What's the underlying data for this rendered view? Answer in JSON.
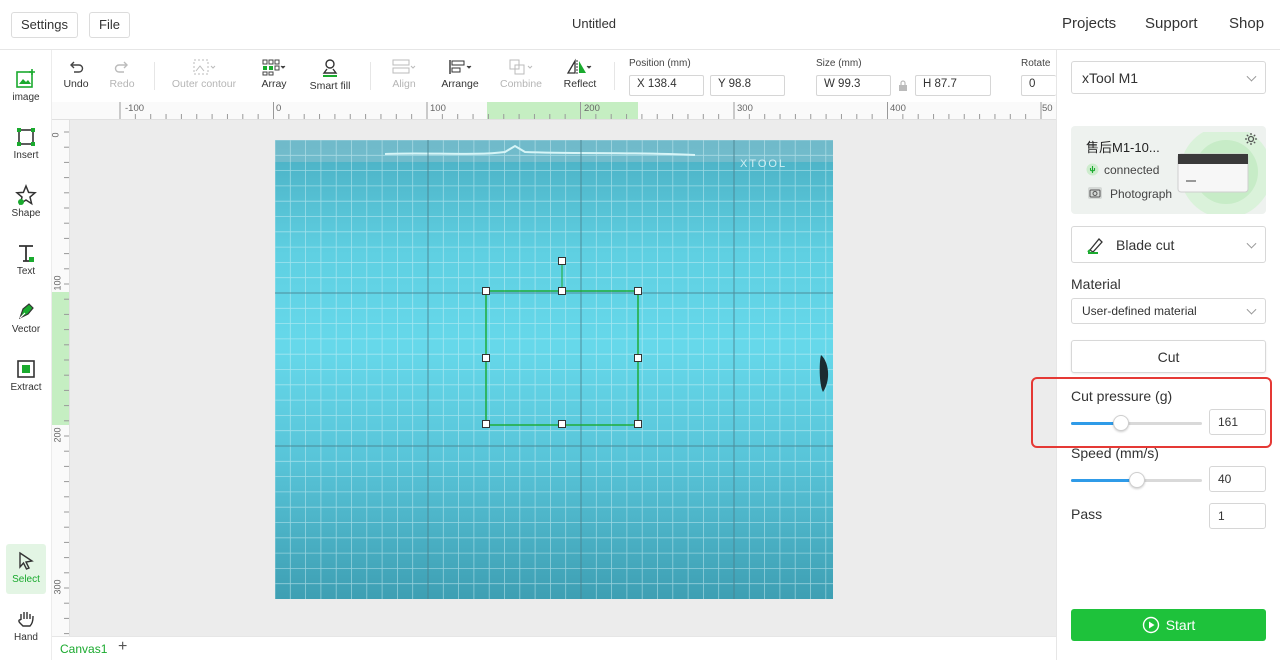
{
  "topbar": {
    "settings_label": "Settings",
    "file_label": "File",
    "title": "Untitled",
    "links": [
      "Projects",
      "Support",
      "Shop"
    ]
  },
  "left_toolbar": {
    "items": [
      {
        "label": "image",
        "icon": "image-add-icon"
      },
      {
        "label": "Insert",
        "icon": "insert-icon"
      },
      {
        "label": "Shape",
        "icon": "shape-star-icon"
      },
      {
        "label": "Text",
        "icon": "text-icon"
      },
      {
        "label": "Vector",
        "icon": "pen-vector-icon"
      },
      {
        "label": "Extract",
        "icon": "extract-icon"
      },
      {
        "label": "Select",
        "icon": "select-cursor-icon",
        "active": true
      },
      {
        "label": "Hand",
        "icon": "hand-icon"
      }
    ]
  },
  "canvas_toolbar": {
    "undo": "Undo",
    "redo": "Redo",
    "outer_contour": "Outer contour",
    "array": "Array",
    "smart_fill": "Smart fill",
    "align": "Align",
    "arrange": "Arrange",
    "combine": "Combine",
    "reflect": "Reflect",
    "position_label": "Position (mm)",
    "pos_x": "X 138.4",
    "pos_y": "Y 98.8",
    "size_label": "Size (mm)",
    "size_w": "W 99.3",
    "size_h": "H 87.7",
    "rotate_label": "Rotate",
    "rotate_value": "0"
  },
  "rulers": {
    "horizontal": [
      "-100",
      "0",
      "100",
      "200",
      "300",
      "400",
      "50"
    ],
    "vertical": [
      "0",
      "100",
      "200",
      "300"
    ]
  },
  "canvas": {
    "tab_label": "Canvas1",
    "add_tab": "+",
    "watermark": "XTOOL"
  },
  "right_panel": {
    "device_select": "xTool M1",
    "device_name": "售后M1-10...",
    "status": "connected",
    "photograph": "Photograph",
    "mode_select": "Blade cut",
    "material_label": "Material",
    "material_select": "User-defined material",
    "cut_button": "Cut",
    "cut_pressure_label": "Cut pressure (g)",
    "cut_pressure_value": "161",
    "cut_pressure_fraction": 0.38,
    "speed_label": "Speed (mm/s)",
    "speed_value": "40",
    "speed_fraction": 0.5,
    "pass_label": "Pass",
    "pass_value": "1",
    "start_button": "Start"
  },
  "colors": {
    "accent": "#1ec23b",
    "highlight": "#e53935",
    "slider": "#2f9be8"
  }
}
